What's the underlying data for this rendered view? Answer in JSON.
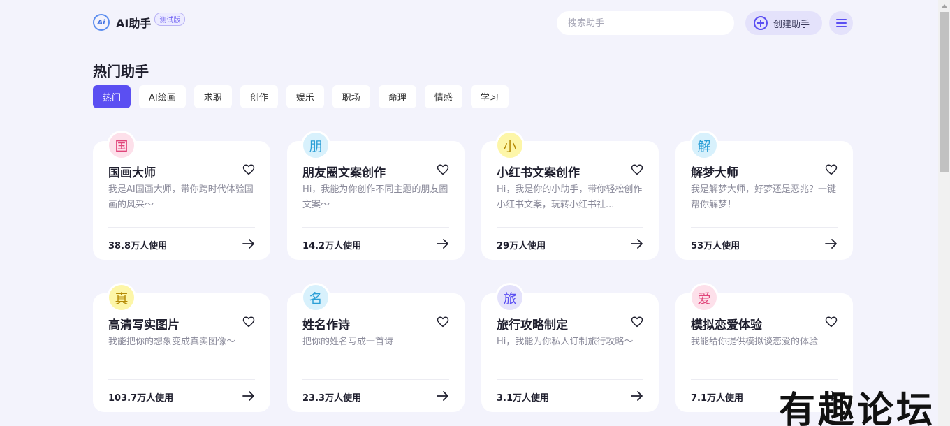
{
  "header": {
    "logo_icon_text": "Ai",
    "app_name": "AI助手",
    "beta_badge": "测试版",
    "search_placeholder": "搜索助手",
    "create_label": "创建助手"
  },
  "section_title": "热门助手",
  "tabs": [
    {
      "label": "热门",
      "active": true
    },
    {
      "label": "AI绘画",
      "active": false
    },
    {
      "label": "求职",
      "active": false
    },
    {
      "label": "创作",
      "active": false
    },
    {
      "label": "娱乐",
      "active": false
    },
    {
      "label": "职场",
      "active": false
    },
    {
      "label": "命理",
      "active": false
    },
    {
      "label": "情感",
      "active": false
    },
    {
      "label": "学习",
      "active": false
    }
  ],
  "cards": [
    {
      "avatar": "国",
      "avatar_bg": "#fde0ea",
      "avatar_color": "#e0457a",
      "title": "国画大师",
      "desc": "我是AI国画大师，带你跨时代体验国画的风采～",
      "usage": "38.8万人使用"
    },
    {
      "avatar": "朋",
      "avatar_bg": "#d8f1fc",
      "avatar_color": "#2b9fd6",
      "title": "朋友圈文案创作",
      "desc": "Hi，我能为你创作不同主题的朋友圈文案～",
      "usage": "14.2万人使用"
    },
    {
      "avatar": "小",
      "avatar_bg": "#fdf6a8",
      "avatar_color": "#b58a05",
      "title": "小红书文案创作",
      "desc": "Hi，我是你的小助手，带你轻松创作小红书文案，玩转小红书社...",
      "usage": "29万人使用"
    },
    {
      "avatar": "解",
      "avatar_bg": "#d8f1fc",
      "avatar_color": "#2b9fd6",
      "title": "解梦大师",
      "desc": "我是解梦大师，好梦还是恶兆？一键帮你解梦！",
      "usage": "53万人使用"
    },
    {
      "avatar": "真",
      "avatar_bg": "#fdf6a8",
      "avatar_color": "#b58a05",
      "title": "高清写实图片",
      "desc": "我能把你的想象变成真实图像～",
      "usage": "103.7万人使用"
    },
    {
      "avatar": "名",
      "avatar_bg": "#d8f1fc",
      "avatar_color": "#2b9fd6",
      "title": "姓名作诗",
      "desc": "把你的姓名写成一首诗",
      "usage": "23.3万人使用"
    },
    {
      "avatar": "旅",
      "avatar_bg": "#e4e2fb",
      "avatar_color": "#5b4ff2",
      "title": "旅行攻略制定",
      "desc": "Hi，我能为你私人订制旅行攻略～",
      "usage": "3.1万人使用"
    },
    {
      "avatar": "爱",
      "avatar_bg": "#fde0ea",
      "avatar_color": "#e0457a",
      "title": "模拟恋爱体验",
      "desc": "我能给你提供模拟谈恋爱的体验",
      "usage": "7.1万人使用"
    }
  ],
  "watermark": "有趣论坛",
  "colors": {
    "accent": "#5b4ff2",
    "background": "#f3f3fc"
  }
}
